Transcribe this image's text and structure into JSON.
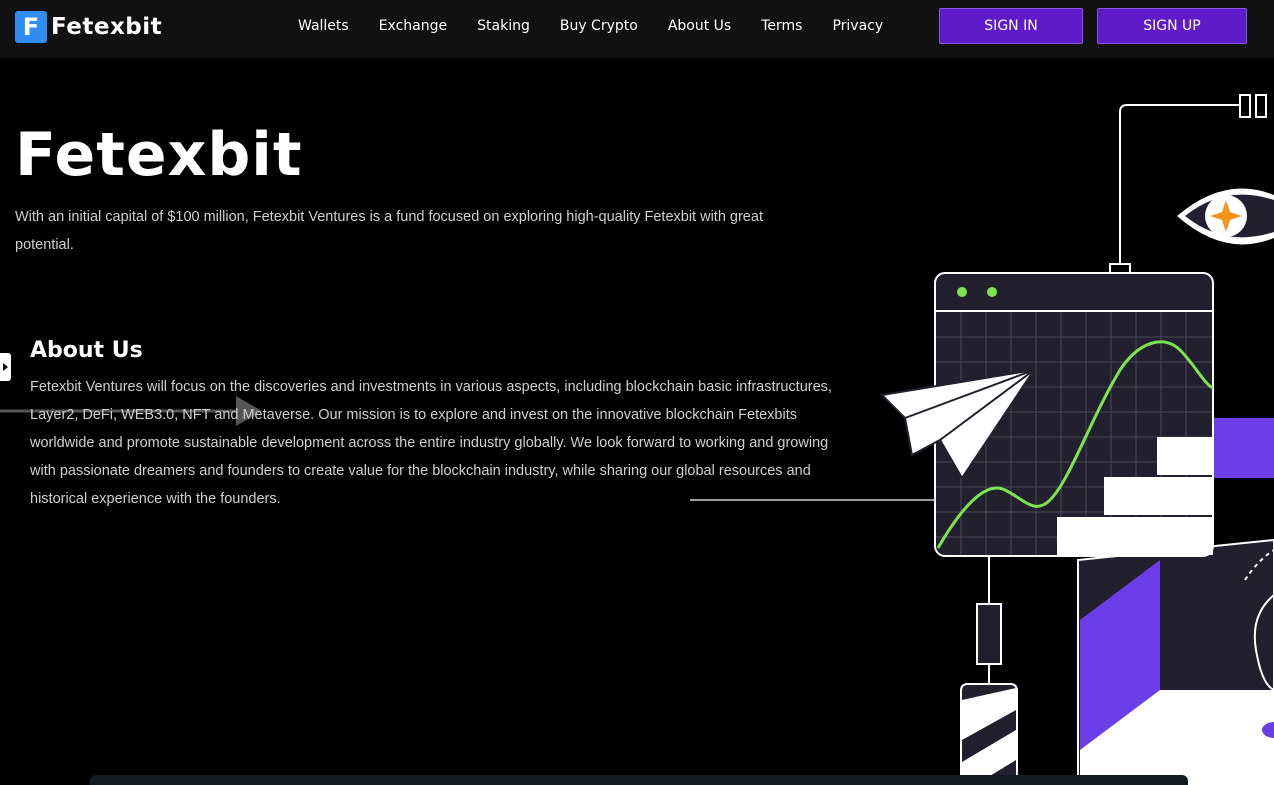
{
  "header": {
    "brand_letter": "F",
    "brand_name": "Fetexbit",
    "nav": [
      "Wallets",
      "Exchange",
      "Staking",
      "Buy Crypto",
      "About Us",
      "Terms",
      "Privacy"
    ],
    "sign_in": "SIGN IN",
    "sign_up": "SIGN UP"
  },
  "hero": {
    "title": "Fetexbit",
    "description": "With an initial capital of $100 million, Fetexbit Ventures is a fund focused on exploring high-quality Fetexbit with great potential."
  },
  "about": {
    "title": "About Us",
    "text": "Fetexbit Ventures will focus on the discoveries and investments in various aspects, including blockchain basic infrastructures, Layer2, DeFi, WEB3.0, NFT and Metaverse. Our mission is to explore and invest on the innovative blockchain Fetexbits worldwide and promote sustainable development across the entire industry globally. We look forward to working and growing with passionate dreamers and founders to create value for the blockchain industry, while sharing our global resources and historical experience with the founders."
  },
  "colors": {
    "accent": "#5f1bc7",
    "brand_blue": "#2f8cf0",
    "chart_green": "#7de34f",
    "purple_block": "#6c3ee8",
    "eye_orange": "#f7941d"
  }
}
